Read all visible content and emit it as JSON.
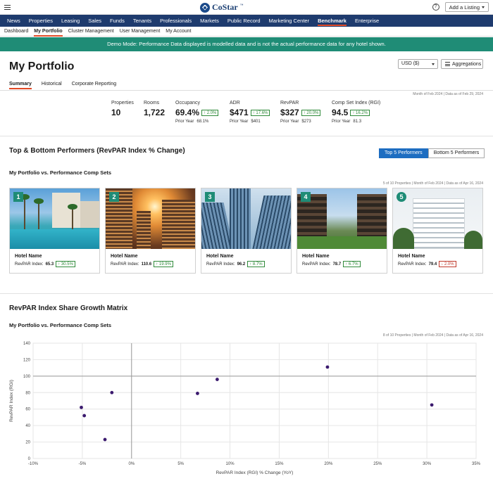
{
  "header": {
    "brand": "CoStar",
    "brand_mark": "™",
    "add_listing_label": "Add a Listing",
    "help_glyph": "?"
  },
  "main_nav": [
    "News",
    "Properties",
    "Leasing",
    "Sales",
    "Funds",
    "Tenants",
    "Professionals",
    "Markets",
    "Public Record",
    "Marketing Center",
    "Benchmark",
    "Enterprise"
  ],
  "main_nav_active": "Benchmark",
  "sub_nav": [
    "Dashboard",
    "My Portfolio",
    "Cluster Management",
    "User Management",
    "My Account"
  ],
  "sub_nav_active": "My Portfolio",
  "banner": "Demo Mode: Performance Data displayed is modelled data and is not the actual performance data for any hotel shown.",
  "page": {
    "title": "My Portfolio",
    "currency": "USD ($)",
    "aggregations_label": "Aggregations",
    "tabs": [
      "Summary",
      "Historical",
      "Corporate Reporting"
    ],
    "active_tab": "Summary",
    "data_note": "Month of Feb 2024 | Data as of Feb 29, 2024"
  },
  "kpis": {
    "properties": {
      "label": "Properties",
      "value": "10"
    },
    "rooms": {
      "label": "Rooms",
      "value": "1,722"
    },
    "occupancy": {
      "label": "Occupancy",
      "value": "69.4%",
      "change": "↑ 2.0%",
      "prior_label": "Prior Year",
      "prior_value": "68.1%"
    },
    "adr": {
      "label": "ADR",
      "value": "$471",
      "change": "↑ 17.6%",
      "prior_label": "Prior Year",
      "prior_value": "$401"
    },
    "revpar": {
      "label": "RevPAR",
      "value": "$327",
      "change": "↑ 20.0%",
      "prior_label": "Prior Year",
      "prior_value": "$273"
    },
    "rgi": {
      "label": "Comp Set Index (RGI)",
      "value": "94.5",
      "change": "↑ 16.2%",
      "prior_label": "Prior Year",
      "prior_value": "81.3"
    }
  },
  "performers": {
    "title": "Top & Bottom Performers (RevPAR Index % Change)",
    "subtitle": "My Portfolio vs. Performance Comp Sets",
    "toggle_top": "Top 5 Performers",
    "toggle_bottom": "Bottom 5 Performers",
    "note": "5 of 10 Properties | Month of Feb 2024 | Data as of Apr 16, 2024",
    "hotels": [
      {
        "rank": "1",
        "name": "Hotel Name",
        "metric_label": "RevPAR Index:",
        "value": "65.3",
        "change": "↑ 30.5%",
        "direction": "up"
      },
      {
        "rank": "2",
        "name": "Hotel Name",
        "metric_label": "RevPAR Index:",
        "value": "110.6",
        "change": "↑ 19.9%",
        "direction": "up"
      },
      {
        "rank": "3",
        "name": "Hotel Name",
        "metric_label": "RevPAR Index:",
        "value": "96.2",
        "change": "↑ 8.7%",
        "direction": "up"
      },
      {
        "rank": "4",
        "name": "Hotel Name",
        "metric_label": "RevPAR Index:",
        "value": "78.7",
        "change": "↑ 6.7%",
        "direction": "up"
      },
      {
        "rank": "5",
        "name": "Hotel Name",
        "metric_label": "RevPAR Index:",
        "value": "79.4",
        "change": "↓ 2.0%",
        "direction": "down"
      }
    ]
  },
  "matrix": {
    "title": "RevPAR Index Share Growth Matrix",
    "subtitle": "My Portfolio vs. Performance Comp Sets",
    "note": "8 of 10 Properties | Month of Feb 2024 | Data as of Apr 16, 2024"
  },
  "chart_data": {
    "type": "scatter",
    "xlabel": "RevPAR Index (RGI) % Change (YoY)",
    "ylabel": "RevPAR Index (RGI)",
    "xlim": [
      -10,
      35
    ],
    "ylim": [
      0,
      140
    ],
    "x_ticks": [
      -10,
      -5,
      0,
      5,
      10,
      15,
      20,
      25,
      30,
      35
    ],
    "x_tick_labels": [
      "-10%",
      "-5%",
      "0%",
      "5%",
      "10%",
      "15%",
      "20%",
      "25%",
      "30%",
      "35%"
    ],
    "y_ticks": [
      0,
      20,
      40,
      60,
      80,
      100,
      120,
      140
    ],
    "y_tick_labels": [
      "0",
      "20",
      "40",
      "60",
      "80",
      "100",
      "120",
      "140"
    ],
    "reference_lines": {
      "x": 0,
      "y": 100
    },
    "grid": true,
    "point_color": "#3b1a6e",
    "points": [
      {
        "x": -5.1,
        "y": 62
      },
      {
        "x": -4.8,
        "y": 52
      },
      {
        "x": -2.7,
        "y": 23
      },
      {
        "x": -2.0,
        "y": 80
      },
      {
        "x": 6.7,
        "y": 79
      },
      {
        "x": 8.7,
        "y": 96
      },
      {
        "x": 19.9,
        "y": 111
      },
      {
        "x": 30.5,
        "y": 65
      }
    ]
  }
}
